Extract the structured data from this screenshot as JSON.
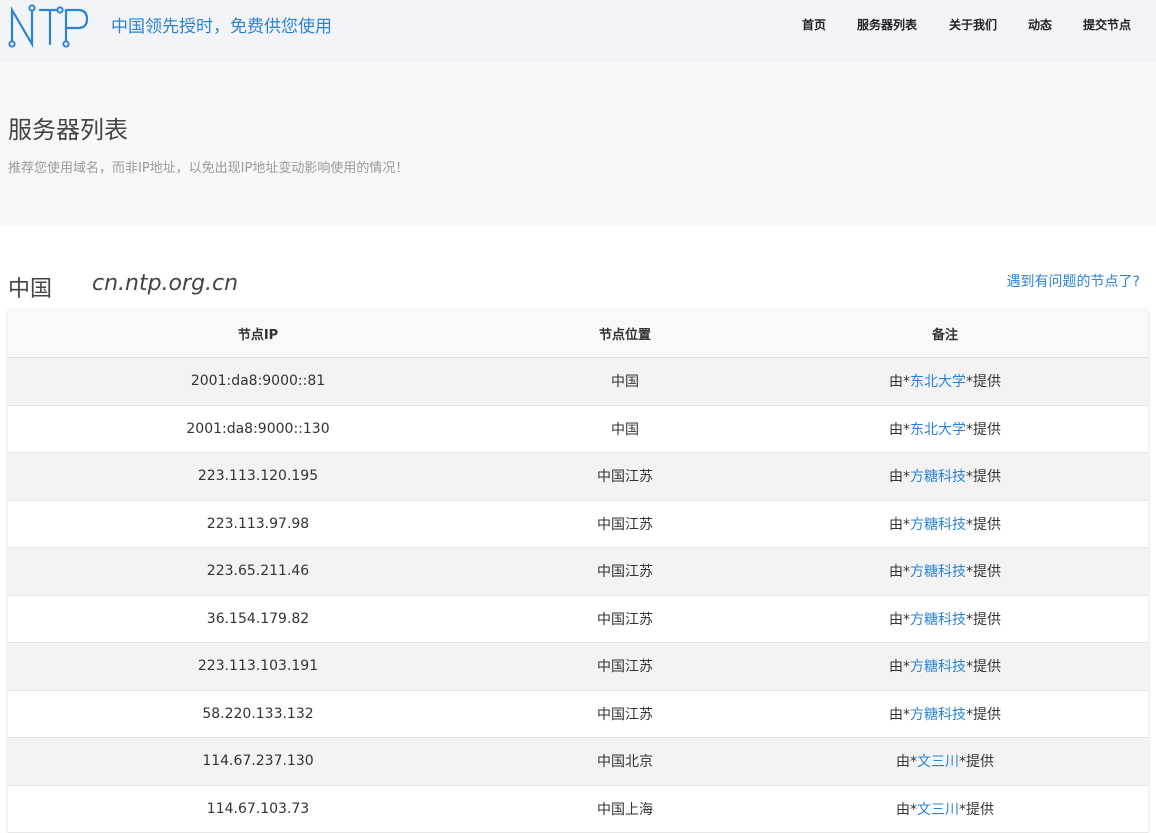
{
  "header": {
    "logo_text": "NTP",
    "tagline": "中国领先授时，免费供您使用",
    "nav": [
      {
        "label": "首页"
      },
      {
        "label": "服务器列表"
      },
      {
        "label": "关于我们"
      },
      {
        "label": "动态"
      },
      {
        "label": "提交节点"
      }
    ],
    "brand_color": "#2b83d6"
  },
  "hero": {
    "title": "服务器列表",
    "subtitle": "推荐您使用域名，而非IP地址，以免出现IP地址变动影响使用的情况！"
  },
  "region": {
    "name": "中国",
    "domain": "cn.ntp.org.cn",
    "issue_link": "遇到有问题的节点了?"
  },
  "table": {
    "headers": {
      "ip": "节点IP",
      "location": "节点位置",
      "note": "备注"
    },
    "rows": [
      {
        "ip": "2001:da8:9000::81",
        "location": "中国",
        "prefix": "由*",
        "provider": "东北大学",
        "suffix": "*提供"
      },
      {
        "ip": "2001:da8:9000::130",
        "location": "中国",
        "prefix": "由*",
        "provider": "东北大学",
        "suffix": "*提供"
      },
      {
        "ip": "223.113.120.195",
        "location": "中国江苏",
        "prefix": "由*",
        "provider": "方糖科技",
        "suffix": "*提供"
      },
      {
        "ip": "223.113.97.98",
        "location": "中国江苏",
        "prefix": "由*",
        "provider": "方糖科技",
        "suffix": "*提供"
      },
      {
        "ip": "223.65.211.46",
        "location": "中国江苏",
        "prefix": "由*",
        "provider": "方糖科技",
        "suffix": "*提供"
      },
      {
        "ip": "36.154.179.82",
        "location": "中国江苏",
        "prefix": "由*",
        "provider": "方糖科技",
        "suffix": "*提供"
      },
      {
        "ip": "223.113.103.191",
        "location": "中国江苏",
        "prefix": "由*",
        "provider": "方糖科技",
        "suffix": "*提供"
      },
      {
        "ip": "58.220.133.132",
        "location": "中国江苏",
        "prefix": "由*",
        "provider": "方糖科技",
        "suffix": "*提供"
      },
      {
        "ip": "114.67.237.130",
        "location": "中国北京",
        "prefix": "由*",
        "provider": "文三川",
        "suffix": "*提供"
      },
      {
        "ip": "114.67.103.73",
        "location": "中国上海",
        "prefix": "由*",
        "provider": "文三川",
        "suffix": "*提供"
      }
    ]
  }
}
